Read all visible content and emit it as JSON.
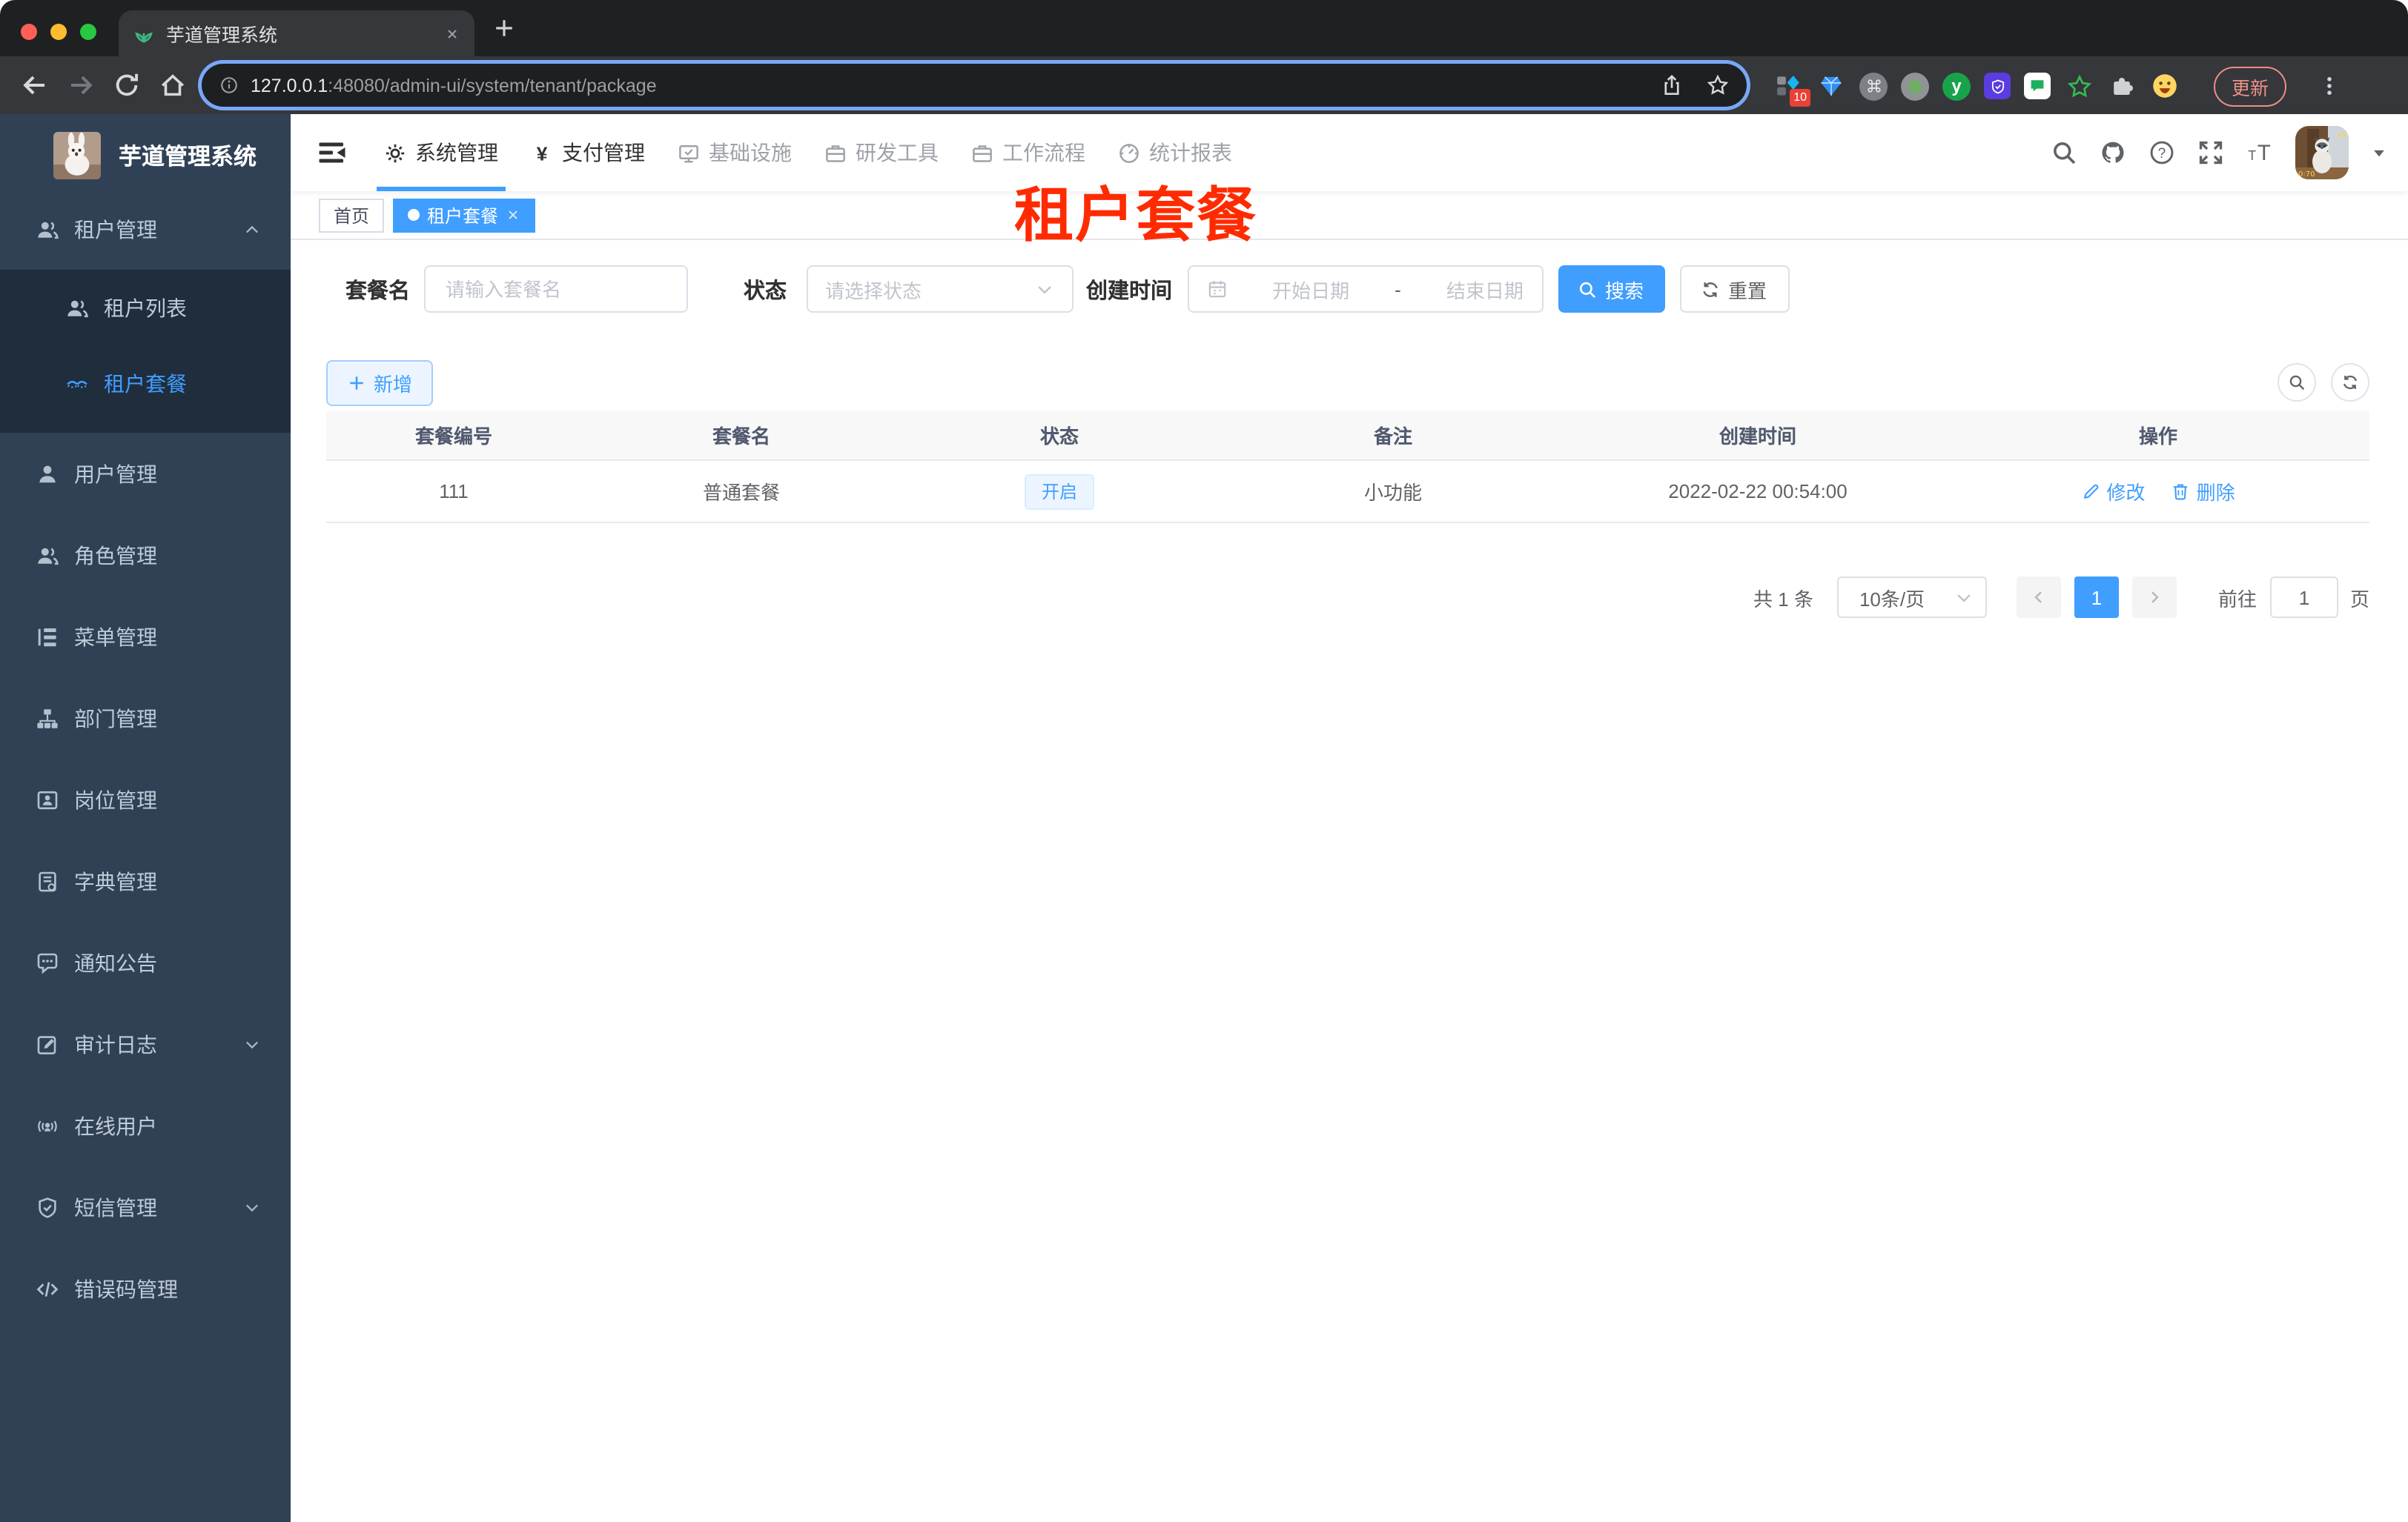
{
  "browser": {
    "tab_title": "芋道管理系统",
    "url_host": "127.0.0.1",
    "url_rest": ":48080/admin-ui/system/tenant/package",
    "extensions_badge": "10",
    "update_button": "更新"
  },
  "sidebar": {
    "logo_title": "芋道管理系统",
    "menu": [
      {
        "label": "租户管理",
        "icon": "users",
        "chevron": "up",
        "children": [
          {
            "label": "租户列表",
            "icon": "users"
          },
          {
            "label": "租户套餐",
            "icon": "peace",
            "active": true
          }
        ]
      },
      {
        "label": "用户管理",
        "icon": "user"
      },
      {
        "label": "角色管理",
        "icon": "users"
      },
      {
        "label": "菜单管理",
        "icon": "tree"
      },
      {
        "label": "部门管理",
        "icon": "org"
      },
      {
        "label": "岗位管理",
        "icon": "post"
      },
      {
        "label": "字典管理",
        "icon": "dict"
      },
      {
        "label": "通知公告",
        "icon": "message"
      },
      {
        "label": "审计日志",
        "icon": "edit",
        "chevron": "down"
      },
      {
        "label": "在线用户",
        "icon": "online"
      },
      {
        "label": "短信管理",
        "icon": "shield",
        "chevron": "down"
      },
      {
        "label": "错误码管理",
        "icon": "code"
      }
    ]
  },
  "topnav": {
    "items": [
      {
        "label": "系统管理",
        "icon": "gear",
        "state": "active"
      },
      {
        "label": "支付管理",
        "icon": "yen",
        "state": "normal"
      },
      {
        "label": "基础设施",
        "icon": "monitor",
        "state": "muted"
      },
      {
        "label": "研发工具",
        "icon": "briefcase",
        "state": "muted"
      },
      {
        "label": "工作流程",
        "icon": "briefcase",
        "state": "muted"
      },
      {
        "label": "统计报表",
        "icon": "gauge",
        "state": "muted"
      }
    ]
  },
  "tags": [
    {
      "label": "首页"
    },
    {
      "label": "租户套餐",
      "active": true
    }
  ],
  "annotation": {
    "text": "租户套餐",
    "color": "#ff2b00"
  },
  "filters": {
    "name_label": "套餐名",
    "name_placeholder": "请输入套餐名",
    "status_label": "状态",
    "status_placeholder": "请选择状态",
    "date_label": "创建时间",
    "date_start_placeholder": "开始日期",
    "date_separator": "-",
    "date_end_placeholder": "结束日期",
    "search_label": "搜索",
    "reset_label": "重置"
  },
  "toolbar": {
    "add_label": "新增"
  },
  "table": {
    "columns": [
      "套餐编号",
      "套餐名",
      "状态",
      "备注",
      "创建时间",
      "操作"
    ],
    "rows": [
      {
        "id": "111",
        "name": "普通套餐",
        "status": "开启",
        "remark": "小功能",
        "created": "2022-02-22 00:54:00",
        "actions": [
          "修改",
          "删除"
        ]
      }
    ]
  },
  "pagination": {
    "total_text": "共 1 条",
    "page_size": "10条/页",
    "current_page": "1",
    "goto_label": "前往",
    "goto_value": "1",
    "page_unit": "页"
  },
  "colors": {
    "accent": "#409eff",
    "sidebar_bg": "#304156",
    "submenu_bg": "#1f2d3d",
    "annotation_red": "#ff2b00",
    "table_header_bg": "#f8f8f9"
  }
}
